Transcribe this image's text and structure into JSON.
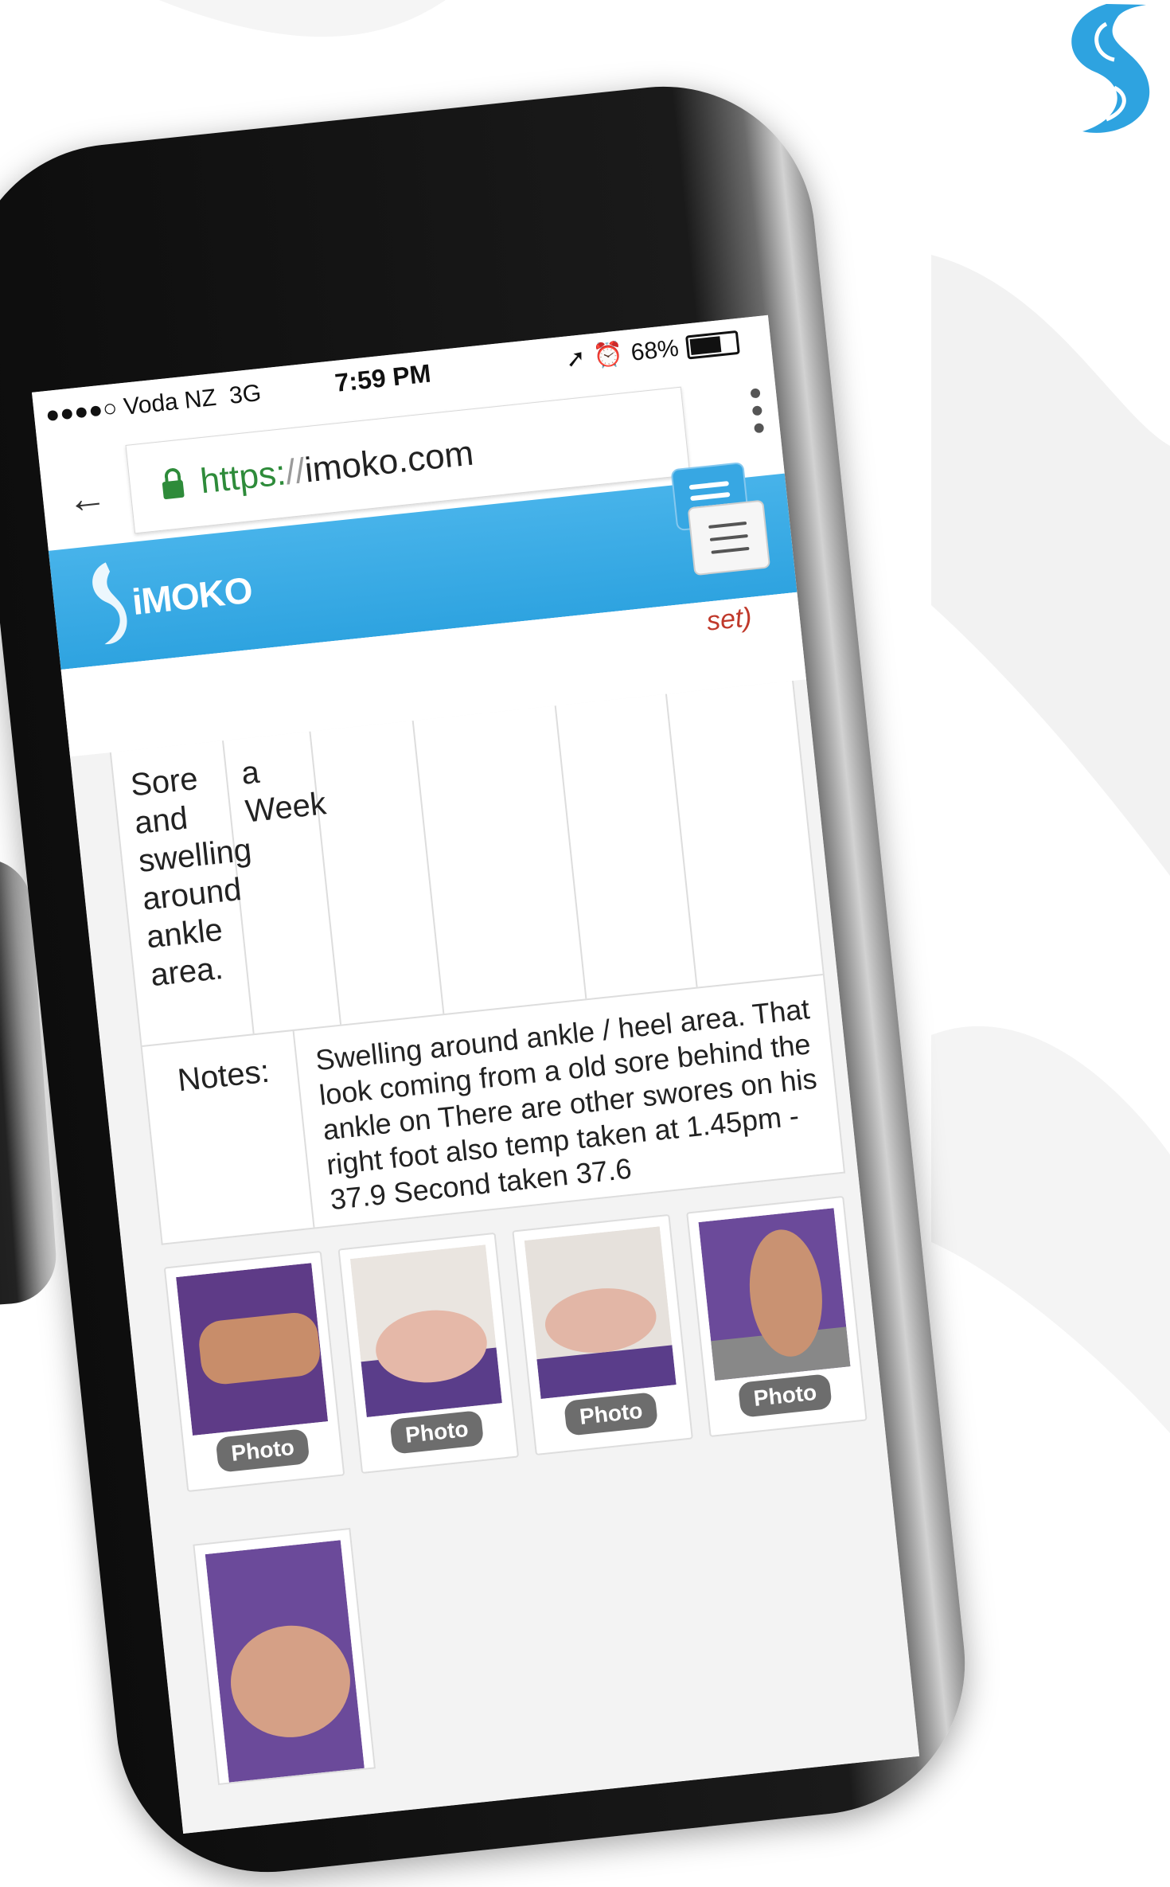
{
  "status_bar": {
    "carrier": "●●●●○ Voda NZ",
    "network": "3G",
    "time": "7:59 PM",
    "battery": "68%",
    "battery_level": 0.68
  },
  "browser": {
    "back_icon": "arrow-left-icon",
    "url_scheme": "https:",
    "url_separator": "//",
    "url_domain": "imoko.com",
    "menu_icon": "kebab-menu-icon"
  },
  "app_header": {
    "logo_text": "iMOKO"
  },
  "table": {
    "header_fragment": "set)",
    "condition_text": "Sore and swelling around ankle area.",
    "duration_text": "a Week",
    "notes_label": "Notes:",
    "notes_text": "Swelling around ankle / heel area. That look coming from a old sore behind the ankle on There are other swores on his right foot also temp taken at 1.45pm - 37.9 Second taken 37.6"
  },
  "photos": [
    {
      "label": "Photo"
    },
    {
      "label": "Photo"
    },
    {
      "label": "Photo"
    },
    {
      "label": "Photo"
    }
  ],
  "colors": {
    "brand_blue": "#2ea3e0",
    "secure_green": "#2e8b3a",
    "accent_red": "#c0392b"
  }
}
